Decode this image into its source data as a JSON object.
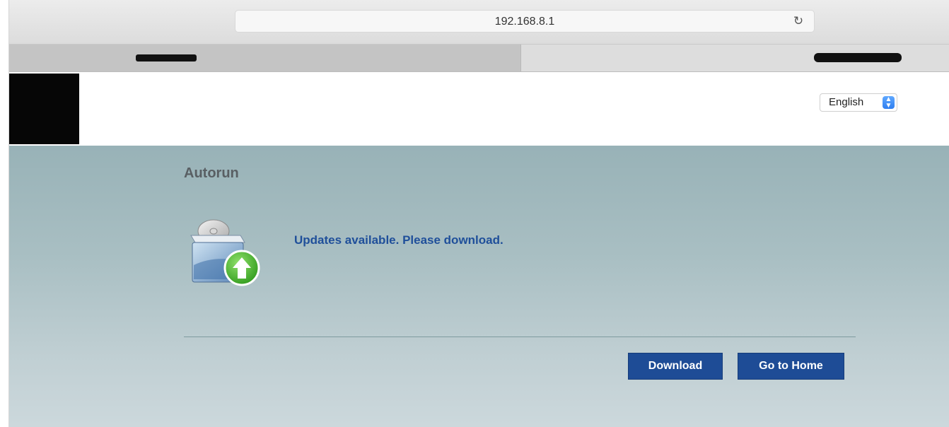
{
  "browser": {
    "address": "192.168.8.1",
    "reload_glyph": "↻"
  },
  "header": {
    "language_selected": "English"
  },
  "main": {
    "title": "Autorun",
    "message": "Updates available. Please download.",
    "download_label": "Download",
    "home_label": "Go to Home"
  },
  "icons": [
    "reload-icon",
    "update-package-icon",
    "select-arrows-icon"
  ],
  "colors": {
    "accent_button": "#1e4c96",
    "message_text": "#1f4f9a",
    "title_text": "#595f63",
    "content_bg_top": "#98b2b7",
    "content_bg_bottom": "#ccd8dc"
  }
}
